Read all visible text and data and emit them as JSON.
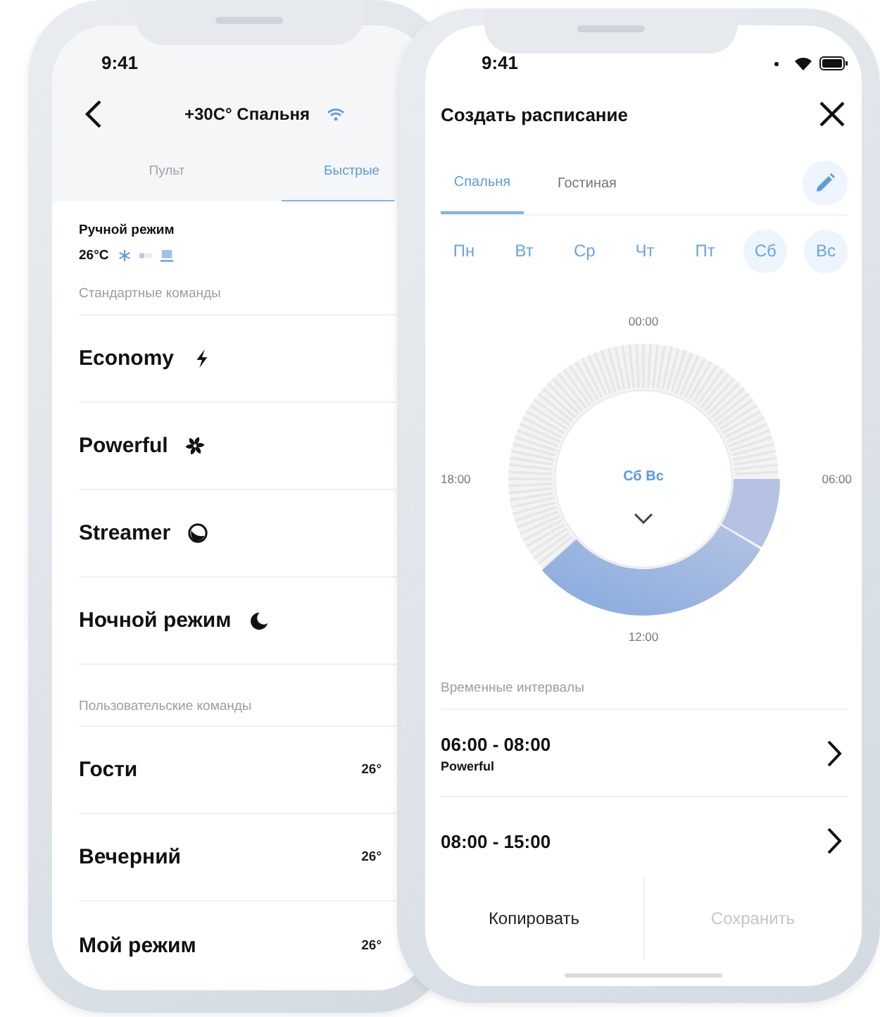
{
  "left_phone": {
    "status_bar": {
      "time": "9:41"
    },
    "header": {
      "title": "+30C° Спальня"
    },
    "tabs": [
      {
        "label": "Пульт",
        "selected": false
      },
      {
        "label": "Быстрые",
        "selected": true
      }
    ],
    "manual_mode": {
      "title": "Ручной режим",
      "temperature": "26°C"
    },
    "standard_commands": {
      "title": "Стандартные команды",
      "items": [
        {
          "name": "Economy"
        },
        {
          "name": "Powerful"
        },
        {
          "name": "Streamer"
        },
        {
          "name": "Ночной режим"
        }
      ]
    },
    "custom_commands": {
      "title": "Пользовательские команды",
      "items": [
        {
          "name": "Гости",
          "value": "26°"
        },
        {
          "name": "Вечерний",
          "value": "26°"
        },
        {
          "name": "Мой режим",
          "value": "26°"
        }
      ]
    }
  },
  "right_phone": {
    "status_bar": {
      "time": "9:41"
    },
    "title": "Создать расписание",
    "tabs": [
      {
        "label": "Спальня",
        "selected": true
      },
      {
        "label": "Гостиная",
        "selected": false
      }
    ],
    "days": [
      {
        "label": "Пн",
        "selected": false
      },
      {
        "label": "Вт",
        "selected": false
      },
      {
        "label": "Ср",
        "selected": false
      },
      {
        "label": "Чт",
        "selected": false
      },
      {
        "label": "Пт",
        "selected": false
      },
      {
        "label": "Сб",
        "selected": true
      },
      {
        "label": "Вс",
        "selected": true
      }
    ],
    "dial": {
      "labels": {
        "top": "00:00",
        "right": "06:00",
        "bottom": "12:00",
        "left": "18:00"
      },
      "center": "Сб Вс"
    },
    "intervals": {
      "title": "Временные интервалы",
      "items": [
        {
          "time": "06:00 - 08:00",
          "mode": "Powerful"
        },
        {
          "time": "08:00 - 15:00"
        }
      ]
    },
    "buttons": [
      {
        "label": "Копировать",
        "disabled": false
      },
      {
        "label": "Сохранить",
        "disabled": true
      }
    ]
  }
}
